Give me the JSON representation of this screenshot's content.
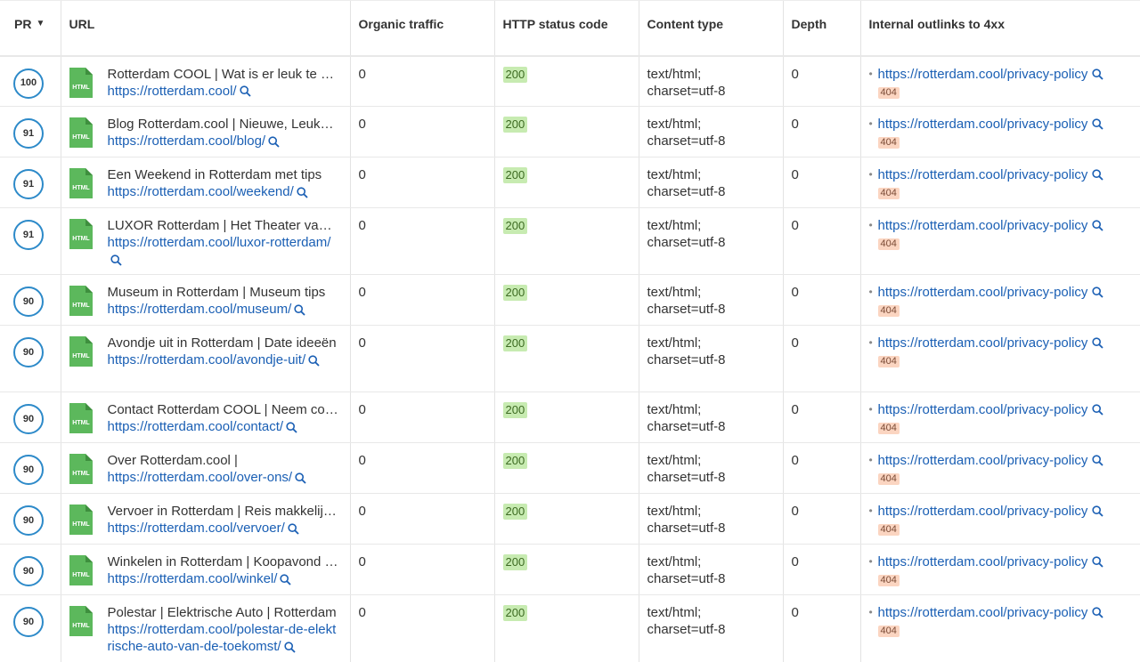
{
  "columns": {
    "pr": "PR",
    "url": "URL",
    "organic_traffic": "Organic traffic",
    "http_status_code": "HTTP status code",
    "content_type": "Content type",
    "depth": "Depth",
    "internal_outlinks_4xx": "Internal outlinks to 4xx"
  },
  "sort": {
    "column": "PR",
    "direction": "descending",
    "icon": "caret-down-icon"
  },
  "icons": {
    "file": "html-file-icon",
    "inspect": "magnifier-icon"
  },
  "colors": {
    "link": "#1a5fb4",
    "pr_ring": "#2d8ac9",
    "status_ok_bg": "#c7ebb1",
    "status_404_bg": "#fbd5c1",
    "file_icon": "#5cb85c"
  },
  "rows": [
    {
      "pr": "100",
      "title": "Rotterdam COOL | Wat is er leuk te doen in Rotterdam",
      "url": "https://rotterdam.cool/",
      "organic_traffic": "0",
      "status": "200",
      "content_type_1": "text/html;",
      "content_type_2": "charset=utf-8",
      "depth": "0",
      "outlink": "https://rotterdam.cool/privacy-policy",
      "outlink_status": "404"
    },
    {
      "pr": "91",
      "title": "Blog Rotterdam.cool | Nieuwe, Leuke tips",
      "url": "https://rotterdam.cool/blog/",
      "organic_traffic": "0",
      "status": "200",
      "content_type_1": "text/html;",
      "content_type_2": "charset=utf-8",
      "depth": "0",
      "outlink": "https://rotterdam.cool/privacy-policy",
      "outlink_status": "404"
    },
    {
      "pr": "91",
      "title": "Een Weekend in Rotterdam met tips",
      "url": "https://rotterdam.cool/weekend/",
      "organic_traffic": "0",
      "status": "200",
      "content_type_1": "text/html;",
      "content_type_2": "charset=utf-8",
      "depth": "0",
      "outlink": "https://rotterdam.cool/privacy-policy",
      "outlink_status": "404"
    },
    {
      "pr": "91",
      "title": "LUXOR Rotterdam | Het Theater van Rotterdam",
      "url": "https://rotterdam.cool/luxor-rotterdam/",
      "organic_traffic": "0",
      "status": "200",
      "content_type_1": "text/html;",
      "content_type_2": "charset=utf-8",
      "depth": "0",
      "outlink": "https://rotterdam.cool/privacy-policy",
      "outlink_status": "404"
    },
    {
      "pr": "90",
      "title": "Museum in Rotterdam | Museum tips",
      "url": "https://rotterdam.cool/museum/",
      "organic_traffic": "0",
      "status": "200",
      "content_type_1": "text/html;",
      "content_type_2": "charset=utf-8",
      "depth": "0",
      "outlink": "https://rotterdam.cool/privacy-policy",
      "outlink_status": "404"
    },
    {
      "pr": "90",
      "title": "Avondje uit in Rotterdam | Date ideeën",
      "url": "https://rotterdam.cool/avondje-uit/",
      "organic_traffic": "0",
      "status": "200",
      "content_type_1": "text/html;",
      "content_type_2": "charset=utf-8",
      "depth": "0",
      "outlink": "https://rotterdam.cool/privacy-policy",
      "outlink_status": "404"
    },
    {
      "pr": "90",
      "title": "Contact Rotterdam COOL | Neem contact op",
      "url": "https://rotterdam.cool/contact/",
      "organic_traffic": "0",
      "status": "200",
      "content_type_1": "text/html;",
      "content_type_2": "charset=utf-8",
      "depth": "0",
      "outlink": "https://rotterdam.cool/privacy-policy",
      "outlink_status": "404"
    },
    {
      "pr": "90",
      "title": "Over Rotterdam.cool |",
      "url": "https://rotterdam.cool/over-ons/",
      "organic_traffic": "0",
      "status": "200",
      "content_type_1": "text/html;",
      "content_type_2": "charset=utf-8",
      "depth": "0",
      "outlink": "https://rotterdam.cool/privacy-policy",
      "outlink_status": "404"
    },
    {
      "pr": "90",
      "title": "Vervoer in Rotterdam | Reis makkelijk door de stad",
      "url": "https://rotterdam.cool/vervoer/",
      "organic_traffic": "0",
      "status": "200",
      "content_type_1": "text/html;",
      "content_type_2": "charset=utf-8",
      "depth": "0",
      "outlink": "https://rotterdam.cool/privacy-policy",
      "outlink_status": "404"
    },
    {
      "pr": "90",
      "title": "Winkelen in Rotterdam | Koopavond en winkels",
      "url": "https://rotterdam.cool/winkel/",
      "organic_traffic": "0",
      "status": "200",
      "content_type_1": "text/html;",
      "content_type_2": "charset=utf-8",
      "depth": "0",
      "outlink": "https://rotterdam.cool/privacy-policy",
      "outlink_status": "404"
    },
    {
      "pr": "90",
      "title": "Polestar | Elektrische Auto | Rotterdam",
      "url": "https://rotterdam.cool/polestar-de-elektrische-auto-van-de-toekomst/",
      "organic_traffic": "0",
      "status": "200",
      "content_type_1": "text/html;",
      "content_type_2": "charset=utf-8",
      "depth": "0",
      "outlink": "https://rotterdam.cool/privacy-policy",
      "outlink_status": "404"
    }
  ]
}
